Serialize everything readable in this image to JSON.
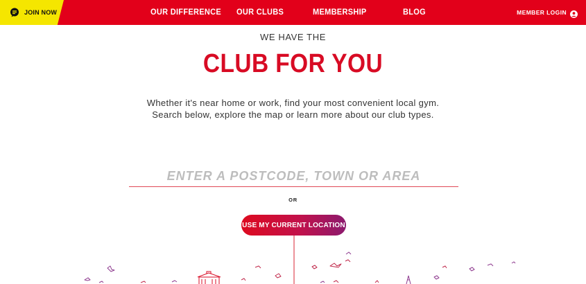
{
  "nav": {
    "join_label": "JOIN NOW",
    "join_icon": "chat-bubble-icon",
    "items": [
      {
        "label": "OUR DIFFERENCE"
      },
      {
        "label": "OUR CLUBS"
      },
      {
        "label": "MEMBERSHIP"
      },
      {
        "label": "BLOG"
      }
    ],
    "member_login_label": "MEMBER LOGIN",
    "member_icon": "user-icon"
  },
  "hero": {
    "eyebrow": "WE HAVE THE",
    "headline": "CLUB FOR YOU",
    "intro": "Whether it's near home or work, find your most convenient local gym. Search below, explore the map or learn more about our club types."
  },
  "search": {
    "placeholder": "ENTER A POSTCODE, TOWN OR AREA",
    "value": ""
  },
  "or_label": "OR",
  "location_button_label": "USE MY CURRENT LOCATION",
  "colors": {
    "brand_red": "#e2001a",
    "headline_red": "#d80b24",
    "join_yellow": "#f5e600",
    "button_gradient_start": "#dd0a1f",
    "button_gradient_end": "#8c1a6e",
    "bird_purple": "#8e3b8f"
  }
}
